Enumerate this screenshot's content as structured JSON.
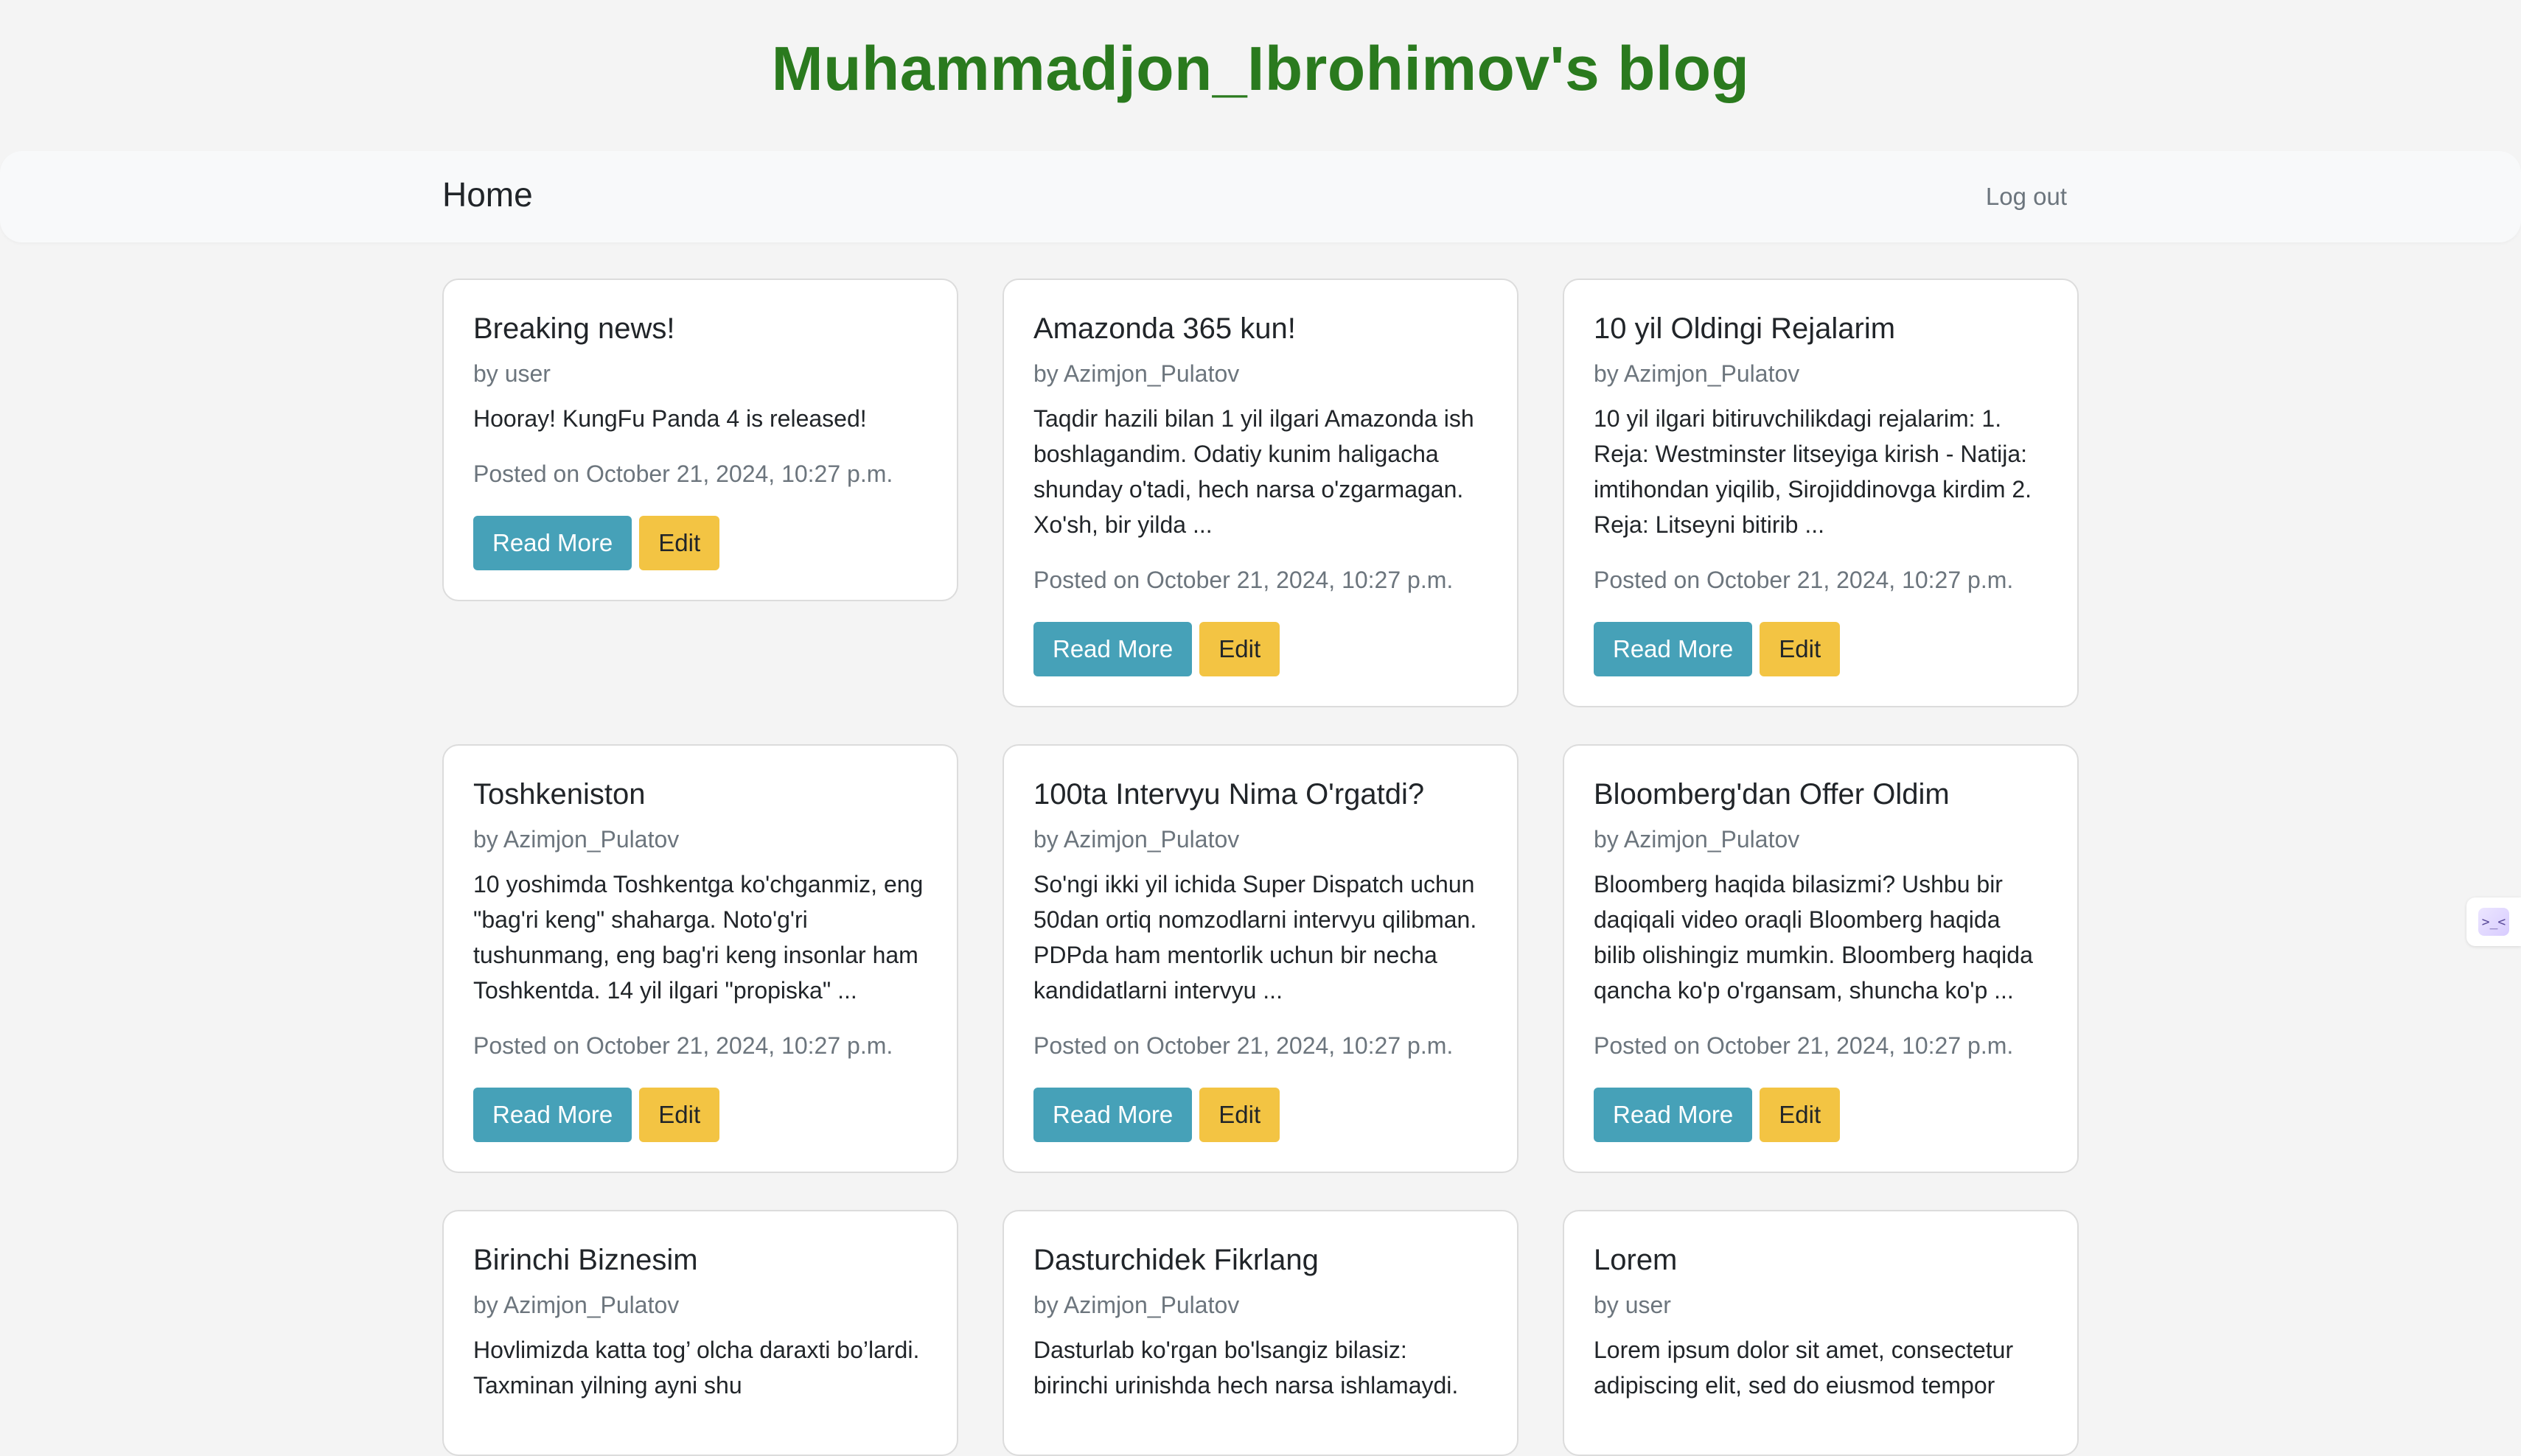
{
  "header": {
    "blog_title": "Muhammadjon_Ibrohimov's blog"
  },
  "nav": {
    "home": "Home",
    "logout": "Log out"
  },
  "buttons": {
    "read_more": "Read More",
    "edit": "Edit"
  },
  "posts": [
    {
      "title": "Breaking news!",
      "author": "by user",
      "excerpt": "Hooray! KungFu Panda 4 is released!",
      "date": "Posted on October 21, 2024, 10:27 p.m."
    },
    {
      "title": "Amazonda 365 kun!",
      "author": "by Azimjon_Pulatov",
      "excerpt": "Taqdir hazili bilan 1 yil ilgari Amazonda ish boshlagandim. Odatiy kunim haligacha shunday o'tadi, hech narsa o'zgarmagan. Xo'sh, bir yilda ...",
      "date": "Posted on October 21, 2024, 10:27 p.m."
    },
    {
      "title": "10 yil Oldingi Rejalarim",
      "author": "by Azimjon_Pulatov",
      "excerpt": "10 yil ilgari bitiruvchilikdagi rejalarim: 1. Reja: Westminster litseyiga kirish - Natija: imtihondan yiqilib, Sirojiddinovga kirdim 2. Reja: Litseyni bitirib ...",
      "date": "Posted on October 21, 2024, 10:27 p.m."
    },
    {
      "title": "Toshkeniston",
      "author": "by Azimjon_Pulatov",
      "excerpt": "10 yoshimda Toshkentga ko'chganmiz, eng \"bag'ri keng\" shaharga. Noto'g'ri tushunmang, eng bag'ri keng insonlar ham Toshkentda. 14 yil ilgari \"propiska\" ...",
      "date": "Posted on October 21, 2024, 10:27 p.m."
    },
    {
      "title": "100ta Intervyu Nima O'rgatdi?",
      "author": "by Azimjon_Pulatov",
      "excerpt": "So'ngi ikki yil ichida Super Dispatch uchun 50dan ortiq nomzodlarni intervyu qilibman. PDPda ham mentorlik uchun bir necha kandidatlarni intervyu ...",
      "date": "Posted on October 21, 2024, 10:27 p.m."
    },
    {
      "title": "Bloomberg'dan Offer Oldim",
      "author": "by Azimjon_Pulatov",
      "excerpt": "Bloomberg haqida bilasizmi? Ushbu bir daqiqali video oraqli Bloomberg haqida bilib olishingiz mumkin. Bloomberg haqida qancha ko'p o'rgansam, shuncha ko'p ...",
      "date": "Posted on October 21, 2024, 10:27 p.m."
    },
    {
      "title": "Birinchi Biznesim",
      "author": "by Azimjon_Pulatov",
      "excerpt": "Hovlimizda katta tog’ olcha daraxti bo’lardi. Taxminan yilning ayni shu",
      "date": ""
    },
    {
      "title": "Dasturchidek Fikrlang",
      "author": "by Azimjon_Pulatov",
      "excerpt": "Dasturlab ko'rgan bo'lsangiz bilasiz: birinchi urinishda hech narsa ishlamaydi.",
      "date": ""
    },
    {
      "title": "Lorem",
      "author": "by user",
      "excerpt": "Lorem ipsum dolor sit amet, consectetur adipiscing elit, sed do eiusmod tempor",
      "date": ""
    }
  ],
  "side_widget": {
    "glyph": ">_<"
  }
}
